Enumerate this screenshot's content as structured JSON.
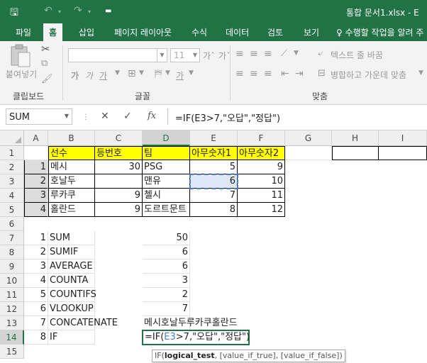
{
  "window": {
    "title": "통합 문서1.xlsx  -  E"
  },
  "quick_access": {
    "save_icon": "save-icon",
    "undo_icon": "undo-icon",
    "redo_icon": "redo-icon",
    "customize_icon": "customize-icon"
  },
  "tabs": [
    {
      "label": "파일"
    },
    {
      "label": "홈"
    },
    {
      "label": "삽입"
    },
    {
      "label": "페이지 레이아웃"
    },
    {
      "label": "수식"
    },
    {
      "label": "데이터"
    },
    {
      "label": "검토"
    },
    {
      "label": "보기"
    }
  ],
  "tell_me": "♀ 수행할 작업을 알려 주",
  "ribbon": {
    "paste_label": "붙여넣기",
    "clipboard_label": "클립보드",
    "font_group_label": "글꼴",
    "font_size": "11",
    "align_group_label": "맞춤",
    "wrap_text": "텍스트 줄 바꿈",
    "merge_center": "병합하고 가운데 맞춤",
    "font_grow": "가ˆ",
    "font_shrink": "가ˇ",
    "bold": "가",
    "italic": "가",
    "underline": "가",
    "font_color": "가"
  },
  "formula_bar": {
    "name_box": "SUM",
    "cancel": "✕",
    "enter": "✓",
    "fx": "fx",
    "formula": "=IF(E3>7,\"오답\",\"정답\")"
  },
  "columns": [
    "A",
    "B",
    "C",
    "D",
    "E",
    "F",
    "G",
    "H",
    "I"
  ],
  "rows": [
    "1",
    "2",
    "3",
    "4",
    "5",
    "6",
    "7",
    "8",
    "9",
    "10",
    "11",
    "12",
    "13",
    "14",
    "15"
  ],
  "cells": {
    "B1": "선수",
    "C1": "등번호",
    "D1": "팀",
    "E1": "아무숫자1",
    "F1": "아무숫자2",
    "A2": "1",
    "B2": "메시",
    "C2": "30",
    "D2": "PSG",
    "E2": "5",
    "F2": "9",
    "A3": "2",
    "B3": "호날두",
    "D3": "맨유",
    "E3": "6",
    "F3": "10",
    "A4": "3",
    "B4": "루카쿠",
    "C4": "9",
    "D4": "첼시",
    "E4": "7",
    "F4": "11",
    "A5": "4",
    "B5": "홀란드",
    "C5": "9",
    "D5": "도르트문트",
    "E5": "8",
    "F5": "12",
    "A7": "1",
    "B7": "SUM",
    "D7": "50",
    "A8": "2",
    "B8": "SUMIF",
    "D8": "6",
    "A9": "3",
    "B9": "AVERAGE",
    "D9": "6",
    "A10": "4",
    "B10": "COUNTA",
    "D10": "3",
    "A11": "5",
    "B11": "COUNTIFS",
    "D11": "2",
    "A12": "6",
    "B12": "VLOOKUP",
    "D12": "7",
    "A13": "7",
    "B13": "CONCATENATE",
    "D13": "메시호날두루카쿠홀란드",
    "A14": "8",
    "B14": "IF"
  },
  "editing_cell": {
    "prefix": "=IF(",
    "ref": "E3",
    "rest": ">7,\"오답\",\"정답\")"
  },
  "tooltip": {
    "fn": "IF(",
    "arg1": "logical_test",
    "rest": ", [value_if_true], [value_if_false])"
  },
  "colors": {
    "excel_green": "#217346",
    "header_yellow": "#ffff00",
    "ref_blue": "#4a7bd0"
  }
}
